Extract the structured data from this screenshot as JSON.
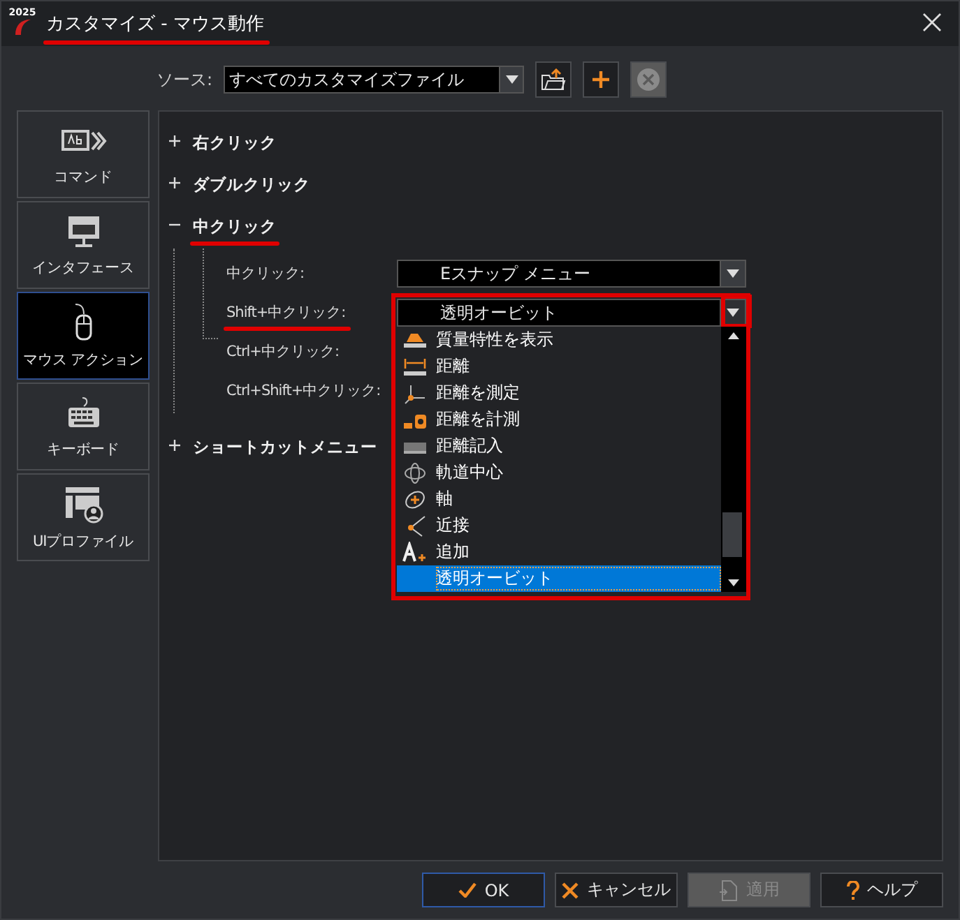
{
  "window": {
    "logo_text": "2025",
    "title": "カスタマイズ - マウス動作",
    "title_underlined": true
  },
  "source": {
    "label": "ソース:",
    "value": "すべてのカスタマイズファイル"
  },
  "toolbar": [
    {
      "kind": "open",
      "disabled": false
    },
    {
      "kind": "add",
      "disabled": false
    },
    {
      "kind": "remove",
      "disabled": true
    }
  ],
  "sidebar": {
    "items": [
      {
        "label": "コマンド",
        "kind": "command",
        "selected": false
      },
      {
        "label": "インタフェース",
        "kind": "interface",
        "selected": false
      },
      {
        "label": "マウス アクション",
        "kind": "mouse",
        "selected": true
      },
      {
        "label": "キーボード",
        "kind": "keyboard",
        "selected": false
      },
      {
        "label": "UIプロファイル",
        "kind": "profile",
        "selected": false
      }
    ]
  },
  "tree": [
    {
      "label": "右クリック",
      "expanded": false,
      "underlined": false
    },
    {
      "label": "ダブルクリック",
      "expanded": false,
      "underlined": false
    },
    {
      "label": "中クリック",
      "expanded": true,
      "underlined": true,
      "children": [
        {
          "label": "中クリック:",
          "value": "Eスナップ メニュー",
          "underlined": false,
          "open": false
        },
        {
          "label": "Shift+中クリック:",
          "value": "透明オービット",
          "underlined": true,
          "open": true
        },
        {
          "label": "Ctrl+中クリック:",
          "underlined": false
        },
        {
          "label": "Ctrl+Shift+中クリック:",
          "underlined": false
        }
      ]
    },
    {
      "label": "ショートカットメニュー",
      "expanded": false,
      "underlined": false
    }
  ],
  "dropdown_list": {
    "highlighted": true,
    "items": [
      {
        "label": "質量特性を表示",
        "selected": false
      },
      {
        "label": "距離",
        "selected": false
      },
      {
        "label": "距離を測定",
        "selected": false
      },
      {
        "label": "距離を計測",
        "selected": false
      },
      {
        "label": "距離記入",
        "selected": false
      },
      {
        "label": "軌道中心",
        "selected": false
      },
      {
        "label": "軸",
        "selected": false
      },
      {
        "label": "近接",
        "selected": false
      },
      {
        "label": "追加",
        "selected": false
      },
      {
        "label": "透明オービット",
        "selected": true
      }
    ]
  },
  "buttons": [
    {
      "label": "OK",
      "kind": "ok",
      "disabled": false,
      "default": true
    },
    {
      "label": "キャンセル",
      "kind": "cancel",
      "disabled": false,
      "default": false
    },
    {
      "label": "適用",
      "kind": "apply",
      "disabled": true,
      "default": false
    },
    {
      "label": "ヘルプ",
      "kind": "help",
      "disabled": false,
      "default": false
    }
  ]
}
